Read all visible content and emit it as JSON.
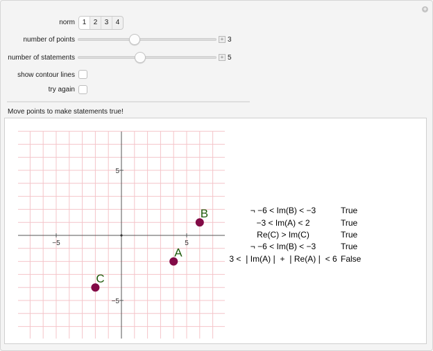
{
  "controls": {
    "norm": {
      "label": "norm",
      "options": [
        "1",
        "2",
        "3",
        "4"
      ],
      "selected": "1"
    },
    "number_of_points": {
      "label": "number of points",
      "value": "3",
      "slider_fraction": 0.41
    },
    "number_of_statements": {
      "label": "number of statements",
      "value": "5",
      "slider_fraction": 0.45
    },
    "show_contour_lines": {
      "label": "show contour lines",
      "checked": false
    },
    "try_again": {
      "label": "try again",
      "checked": false
    }
  },
  "instruction": "Move points to make statements true!",
  "plot": {
    "x_ticks": [
      "−5",
      "5"
    ],
    "y_ticks": [
      "5",
      "−5"
    ],
    "grid_color": "#f4c4c9",
    "point_color": "#820a46",
    "label_color": "#1e5a0a",
    "points": [
      {
        "name": "A",
        "x": 4,
        "y": -2
      },
      {
        "name": "B",
        "x": 6,
        "y": 1
      },
      {
        "name": "C",
        "x": -2,
        "y": -4
      }
    ]
  },
  "statements": [
    {
      "text": "¬ −6 < Im(B) < −3",
      "value": "True"
    },
    {
      "text": "−3 < Im(A) < 2",
      "value": "True"
    },
    {
      "text": "Re(C) > Im(C)",
      "value": "True"
    },
    {
      "text": "¬ −6 < Im(B) < −3",
      "value": "True"
    },
    {
      "text": "3 < ❘Im(A)❘ + ❘Re(A)❘ < 6",
      "value": "False"
    }
  ]
}
